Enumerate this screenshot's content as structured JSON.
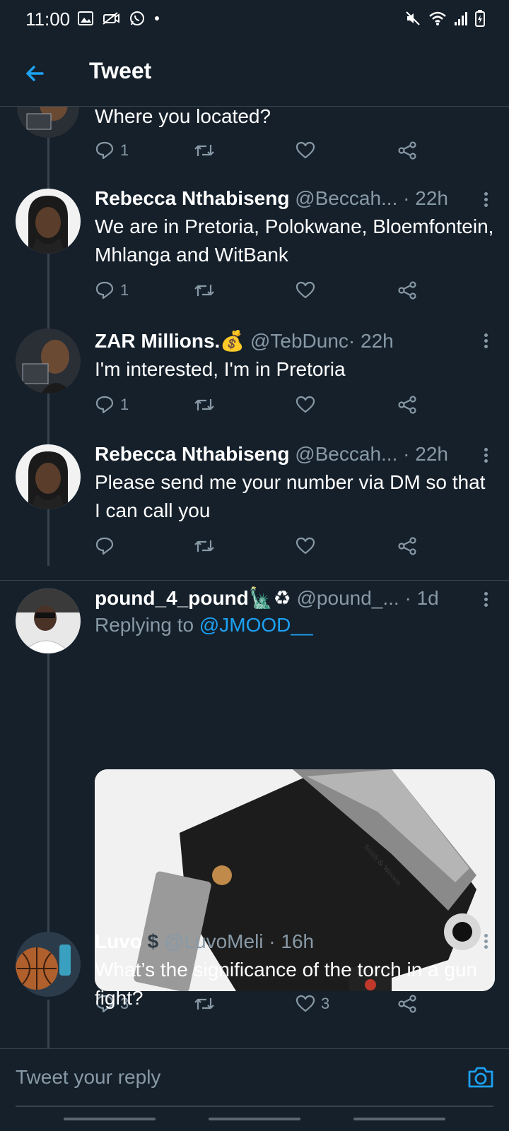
{
  "status_bar": {
    "time": "11:00"
  },
  "app_bar": {
    "title": "Tweet"
  },
  "tweets": [
    {
      "name": "",
      "handle": "",
      "time": "",
      "text": "Where you located?",
      "reply_count": "1",
      "like_count": ""
    },
    {
      "name": "Rebecca Nthabiseng",
      "handle": "@Beccah...",
      "time": "· 22h",
      "text": "We are in Pretoria, Polokwane, Bloemfontein, Mhlanga and WitBank",
      "reply_count": "1",
      "like_count": ""
    },
    {
      "name": "ZAR Millions.💰",
      "handle": "@TebDunc",
      "time": "· 22h",
      "text": "I'm interested, I'm in Pretoria",
      "reply_count": "1",
      "like_count": ""
    },
    {
      "name": "Rebecca Nthabiseng",
      "handle": "@Beccah...",
      "time": "· 22h",
      "text": "Please send me your number via DM so that I can call you",
      "reply_count": "",
      "like_count": ""
    },
    {
      "name": "pound_4_pound🗽♻",
      "handle": "@pound_...",
      "time": "· 1d",
      "reply_prefix": "Replying to",
      "reply_mention": "@JMOOD__",
      "media_text": "Smith & Wesson",
      "reply_count": "3",
      "like_count": "3"
    },
    {
      "name": "Luvo",
      "handle": "@LuvoMeli",
      "time": "· 16h",
      "text": "What’s the significance of the torch in a gun fight?",
      "reply_count": "",
      "like_count": ""
    }
  ],
  "reply_input": {
    "placeholder": "Tweet your reply"
  },
  "colors": {
    "background": "#15202b",
    "accent": "#1da1f2",
    "muted": "#8899a6",
    "divider": "#38444d"
  }
}
